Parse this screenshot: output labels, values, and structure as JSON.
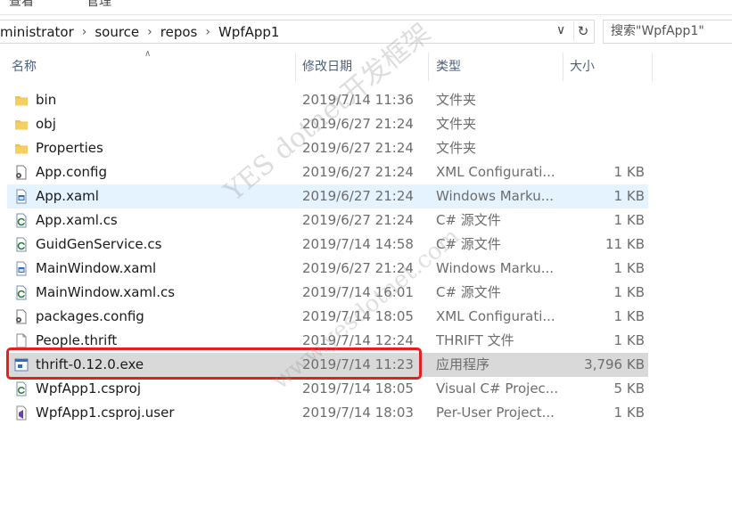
{
  "ribbon": {
    "tab_view": "查看",
    "tab_manage": "管理"
  },
  "address": {
    "crumbs": [
      "ministrator",
      "source",
      "repos",
      "WpfApp1"
    ],
    "separator": "›"
  },
  "search": {
    "placeholder": "搜索\"WpfApp1\""
  },
  "columns": {
    "name": "名称",
    "date": "修改日期",
    "type": "类型",
    "size": "大小"
  },
  "files": [
    {
      "icon": "folder-icon",
      "name": "bin",
      "date": "2019/7/14 11:36",
      "type": "文件夹",
      "size": ""
    },
    {
      "icon": "folder-icon",
      "name": "obj",
      "date": "2019/6/27 21:24",
      "type": "文件夹",
      "size": ""
    },
    {
      "icon": "folder-icon",
      "name": "Properties",
      "date": "2019/6/27 21:24",
      "type": "文件夹",
      "size": ""
    },
    {
      "icon": "config-file-icon",
      "name": "App.config",
      "date": "2019/6/27 21:24",
      "type": "XML Configurati...",
      "size": "1 KB"
    },
    {
      "icon": "xaml-file-icon",
      "name": "App.xaml",
      "date": "2019/6/27 21:24",
      "type": "Windows Marku...",
      "size": "1 KB"
    },
    {
      "icon": "csharp-file-icon",
      "name": "App.xaml.cs",
      "date": "2019/6/27 21:24",
      "type": "C# 源文件",
      "size": "1 KB"
    },
    {
      "icon": "csharp-file-icon",
      "name": "GuidGenService.cs",
      "date": "2019/7/14 14:58",
      "type": "C# 源文件",
      "size": "11 KB"
    },
    {
      "icon": "xaml-file-icon",
      "name": "MainWindow.xaml",
      "date": "2019/6/27 21:24",
      "type": "Windows Marku...",
      "size": "1 KB"
    },
    {
      "icon": "csharp-file-icon",
      "name": "MainWindow.xaml.cs",
      "date": "2019/7/14 16:01",
      "type": "C# 源文件",
      "size": "1 KB"
    },
    {
      "icon": "config-file-icon",
      "name": "packages.config",
      "date": "2019/7/14 18:05",
      "type": "XML Configurati...",
      "size": "1 KB"
    },
    {
      "icon": "text-file-icon",
      "name": "People.thrift",
      "date": "2019/7/14 12:24",
      "type": "THRIFT 文件",
      "size": "1 KB"
    },
    {
      "icon": "exe-file-icon",
      "name": "thrift-0.12.0.exe",
      "date": "2019/7/14 11:23",
      "type": "应用程序",
      "size": "3,796 KB"
    },
    {
      "icon": "csproj-file-icon",
      "name": "WpfApp1.csproj",
      "date": "2019/7/14 18:05",
      "type": "Visual C# Projec...",
      "size": "5 KB"
    },
    {
      "icon": "vs-user-file-icon",
      "name": "WpfApp1.csproj.user",
      "date": "2019/7/14 18:03",
      "type": "Per-User Project...",
      "size": "1 KB"
    }
  ],
  "hover_row": 4,
  "selected_row": 11,
  "watermark": {
    "line1": "YES  dotnet开发框架",
    "line2": "www.yesdotnet.com"
  },
  "colors": {
    "highlight": "#e32020",
    "folder": "#f2c14e",
    "selected": "#d9d9d9",
    "hover": "#e5f3ff"
  }
}
